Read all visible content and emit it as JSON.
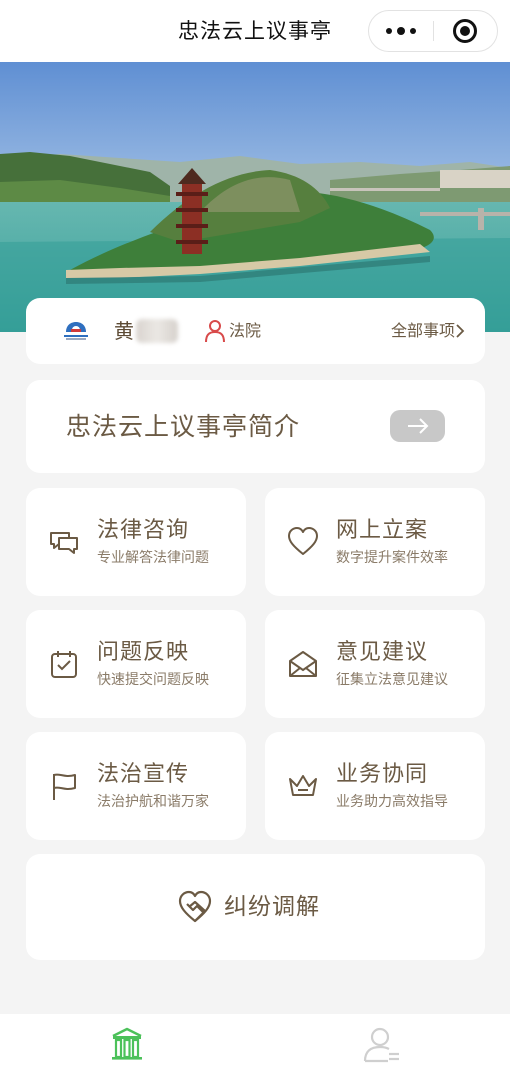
{
  "navbar": {
    "title": "忠法云上议事亭",
    "more_icon": "more-dots-icon",
    "close_icon": "target-close-icon"
  },
  "user": {
    "surname": "黄",
    "role": "法院",
    "all_items_label": "全部事项"
  },
  "intro": {
    "title": "忠法云上议事亭简介"
  },
  "services": [
    {
      "title": "法律咨询",
      "subtitle": "专业解答法律问题",
      "icon": "chat-bubbles-icon"
    },
    {
      "title": "网上立案",
      "subtitle": "数字提升案件效率",
      "icon": "heart-icon"
    },
    {
      "title": "问题反映",
      "subtitle": "快速提交问题反映",
      "icon": "calendar-check-icon"
    },
    {
      "title": "意见建议",
      "subtitle": "征集立法意见建议",
      "icon": "open-envelope-icon"
    },
    {
      "title": "法治宣传",
      "subtitle": "法治护航和谐万家",
      "icon": "flag-icon"
    },
    {
      "title": "业务协同",
      "subtitle": "业务助力高效指导",
      "icon": "crown-icon"
    }
  ],
  "mediation": {
    "title": "纠纷调解",
    "icon": "handshake-heart-icon"
  },
  "tabbar": {
    "active": "home",
    "tabs": [
      {
        "key": "home",
        "icon": "building-icon"
      },
      {
        "key": "mine",
        "icon": "user-icon"
      }
    ]
  },
  "colors": {
    "accent_text": "#6b5a44",
    "tab_active": "#4cc15a",
    "tab_inactive": "#cfcfcf",
    "page_bg": "#f4f4f4",
    "card_bg": "#ffffff"
  }
}
